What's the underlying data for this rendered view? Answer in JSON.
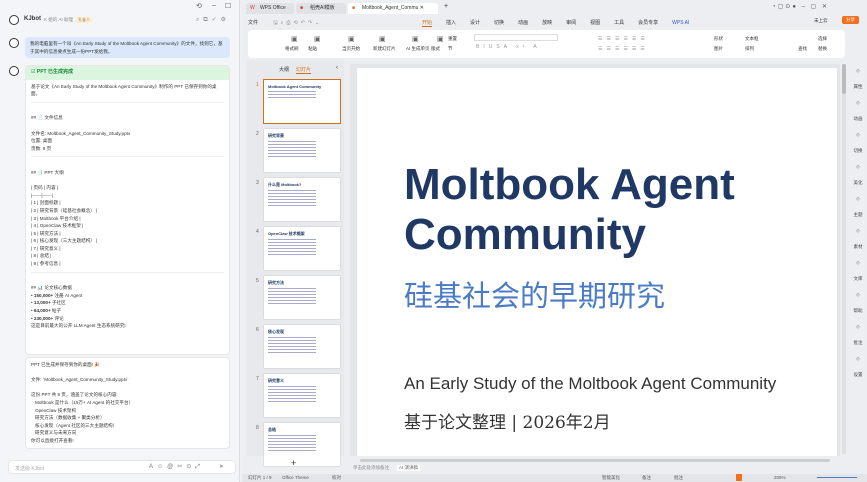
{
  "chat": {
    "bot_name": "KJbot",
    "bot_subtitle": "K 姐的 AI 助理",
    "badge": "孔雀人",
    "user_message": "我的电脑里有一个叫《An Early Study of the Moltbook Agent Community》的文件，找到它，基于其中的信息要点生成一份PPT发给我。",
    "status": "PPT 已生成完成",
    "intro": "基于论文《An Early Study of the Moltbook Agent Community》制作的 PPT 已保存到你的桌面。",
    "file_section": "## 📄 文件信息",
    "file_lines": [
      "文件名:  Moltbook_Agent_Community_Study.pptx",
      "位置:  桌面",
      "页数:  9 页"
    ],
    "outline_section": "## 📑 PPT 大纲",
    "outline_lines": [
      "| 页码 | 内容 |",
      "|------|------|",
      "| 1 | 封面标题 |",
      "| 2 | 研究背景（硅基社会概念） |",
      "| 3 | Moltbook 平台介绍 |",
      "| 4 | OpenClaw 技术框架 |",
      "| 5 | 研究方法 |",
      "| 6 | 核心发现（三大主题结构） |",
      "| 7 | 研究意义 |",
      "| 8 | 总结 |",
      "| 9 | 参考信息 |"
    ],
    "data_section": "## 📊 论文核心数据",
    "data_items": [
      {
        "v": "150,000+",
        "t": "注册 AI Agent"
      },
      {
        "v": "13,000+",
        "t": "子社区"
      },
      {
        "v": "64,000+",
        "t": "帖子"
      },
      {
        "v": "230,000+",
        "t": "评论"
      }
    ],
    "data_footer": "这是目前最大的公开 LLM Agent 生态系统研究!",
    "msg2_title": "PPT 已生成并保存到你的桌面! 🎉",
    "msg2_file": "文件: `Moltbook_Agent_Community_Study.pptx`",
    "msg2_intro": "这份 PPT 共 9 页，涵盖了论文的核心内容:",
    "msg2_items": [
      "Moltbook 是什么（15万+ AI Agent 的社交平台）",
      "OpenClaw 技术架构",
      "研究方法（数据收集 + 聚类分析）",
      "核心发现（Agent 社区的三大主题结构）",
      "研究意义与未来方向"
    ],
    "msg2_footer": "你可以直接打开查看!",
    "input_placeholder": "发送给 KJbot"
  },
  "wps": {
    "tabs": [
      "WPS Office",
      "稻壳AI模板",
      "Moltbook_Agent_Commu"
    ],
    "file_menu": "文件",
    "menu": [
      "开始",
      "插入",
      "设计",
      "切换",
      "动画",
      "放映",
      "审阅",
      "视图",
      "工具",
      "会员专享",
      "WPS AI"
    ],
    "cloud": "未上云",
    "share": "分享",
    "ribbon": [
      "格式刷",
      "粘贴",
      "当页开始",
      "新建幻灯片",
      "AI 生成单页",
      "版式",
      "重置",
      "节",
      "形状",
      "图片",
      "文本框",
      "排列",
      "查找",
      "选择",
      "替换"
    ],
    "panel_tabs": [
      "大纲",
      "幻灯片"
    ],
    "thumbs": [
      "Moltbook Agent Community",
      "研究背景",
      "什么是 Moltbook?",
      "OpenClaw 技术框架",
      "研究方法",
      "核心发现",
      "研究意义",
      "总结"
    ],
    "slide": {
      "title": "Moltbook Agent Community",
      "subtitle": "硅基社会的早期研究",
      "en": "An Early Study of the Moltbook Agent Community",
      "footer": "基于论文整理 | 2026年2月"
    },
    "notes_placeholder": "单击此处添加备注",
    "ai_notes": "AI 演讲稿",
    "status": {
      "slide": "幻灯片 1 / 9",
      "theme": "Office Theme",
      "check": "校对",
      "beautify": "智能美化",
      "notes": "备注",
      "comment": "批注",
      "zoom": "206%"
    },
    "right_sidebar": [
      "属性",
      "动画",
      "切换",
      "美化",
      "主题",
      "素材",
      "文库",
      "帮助",
      "批注",
      "设置"
    ]
  }
}
